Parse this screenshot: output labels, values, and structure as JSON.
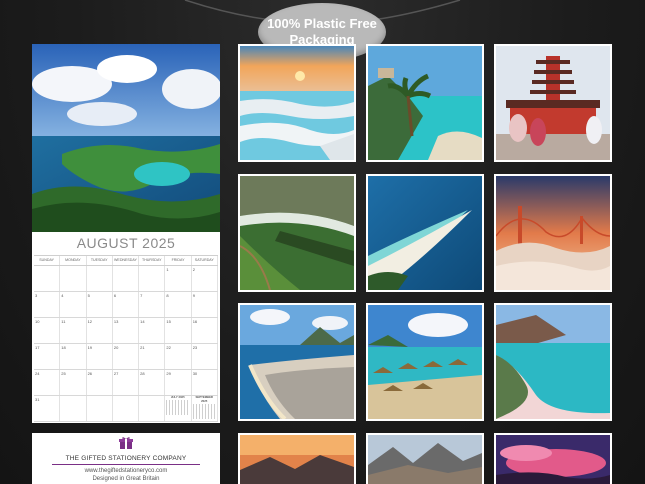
{
  "badge": {
    "line1": "100% Plastic Free",
    "line2": "Packaging"
  },
  "calendar": {
    "month_title": "AUGUST 2025",
    "weekdays": [
      "SUNDAY",
      "MONDAY",
      "TUESDAY",
      "WEDNESDAY",
      "THURSDAY",
      "FRIDAY",
      "SATURDAY"
    ],
    "weeks": [
      [
        "",
        "",
        "",
        "",
        "",
        "1",
        "2"
      ],
      [
        "3",
        "4",
        "5",
        "6",
        "7",
        "8",
        "9"
      ],
      [
        "10",
        "11",
        "12",
        "13",
        "14",
        "15",
        "16"
      ],
      [
        "17",
        "18",
        "19",
        "20",
        "21",
        "22",
        "23"
      ],
      [
        "24",
        "25",
        "26",
        "27",
        "28",
        "29",
        "30"
      ],
      [
        "31",
        "",
        "",
        "",
        "",
        "",
        ""
      ]
    ],
    "mini_months": [
      "JULY 2025",
      "SEPTEMBER 2025"
    ]
  },
  "brand": {
    "company": "THE GIFTED STATIONERY COMPANY",
    "url": "www.thegiftedstationeryco.com",
    "made_in": "Designed in Great Britain",
    "accent": "#7a2f86"
  },
  "colors": {
    "background": "#1e1e1e",
    "badge": "#b9b9b9"
  }
}
